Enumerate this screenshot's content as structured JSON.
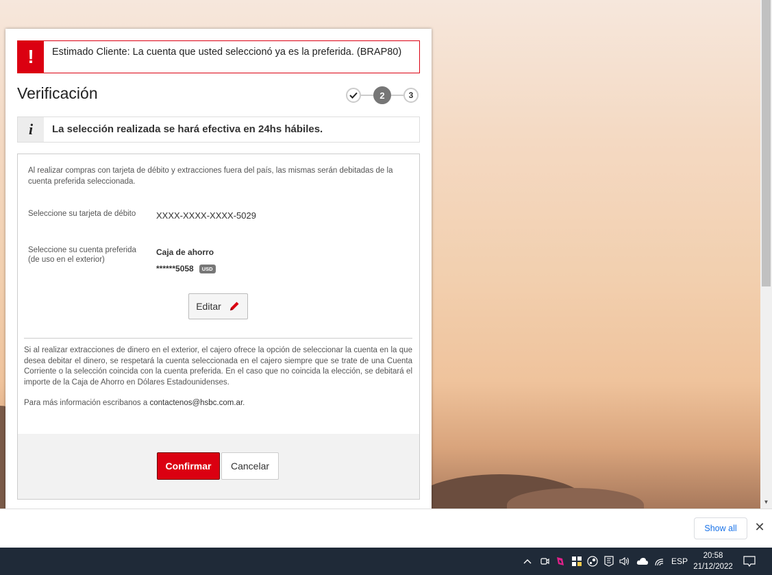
{
  "alert": {
    "icon": "!",
    "message": "Estimado Cliente: La cuenta que usted seleccionó ya es la preferida. (BRAP80)"
  },
  "header": {
    "title": "Verificación",
    "steps": [
      {
        "label": "",
        "state": "done",
        "icon": "checkmark-icon"
      },
      {
        "label": "2",
        "state": "active"
      },
      {
        "label": "3",
        "state": "pending"
      }
    ]
  },
  "info": {
    "icon": "i",
    "message": "La selección realizada se hará efectiva en 24hs hábiles."
  },
  "form": {
    "intro": "Al realizar compras con tarjeta de débito y extracciones fuera del país, las mismas serán debitadas de la cuenta preferida seleccionada.",
    "card_label": "Seleccione su tarjeta de débito",
    "card_value": "XXXX-XXXX-XXXX-5029",
    "account_label_line1": "Seleccione su cuenta preferida",
    "account_label_line2": "(de uso en el exterior)",
    "account_type": "Caja de ahorro",
    "account_number": "******5058",
    "account_currency": "USD",
    "edit_label": "Editar",
    "note": "Si al realizar extracciones de dinero en el exterior, el cajero ofrece la opción de seleccionar la cuenta en la que desea debitar el dinero, se respetará la cuenta seleccionada en el cajero siempre que se trate de una Cuenta Corriente o la selección coincida con la cuenta preferida. En el caso que no coincida la elección, se debitará el importe de la Caja de Ahorro en Dólares Estadounidenses.",
    "contact_prefix": "Para más información escribanos a ",
    "contact_email": "contactenos@hsbc.com.ar",
    "contact_suffix": ".",
    "confirm_label": "Confirmar",
    "cancel_label": "Cancelar"
  },
  "colors": {
    "brand_red": "#db0011",
    "link_blue": "#1a73e8",
    "taskbar": "#1f2a38"
  },
  "download_bar": {
    "show_all_label": "Show all",
    "close_icon": "✕"
  },
  "taskbar": {
    "tray_icons": [
      "chevron-up-icon",
      "meet-now-icon",
      "app-icon",
      "security-icon",
      "steam-icon",
      "epic-games-icon",
      "volume-icon",
      "onedrive-icon",
      "wifi-icon"
    ],
    "language": "ESP",
    "time": "20:58",
    "date": "21/12/2022"
  }
}
